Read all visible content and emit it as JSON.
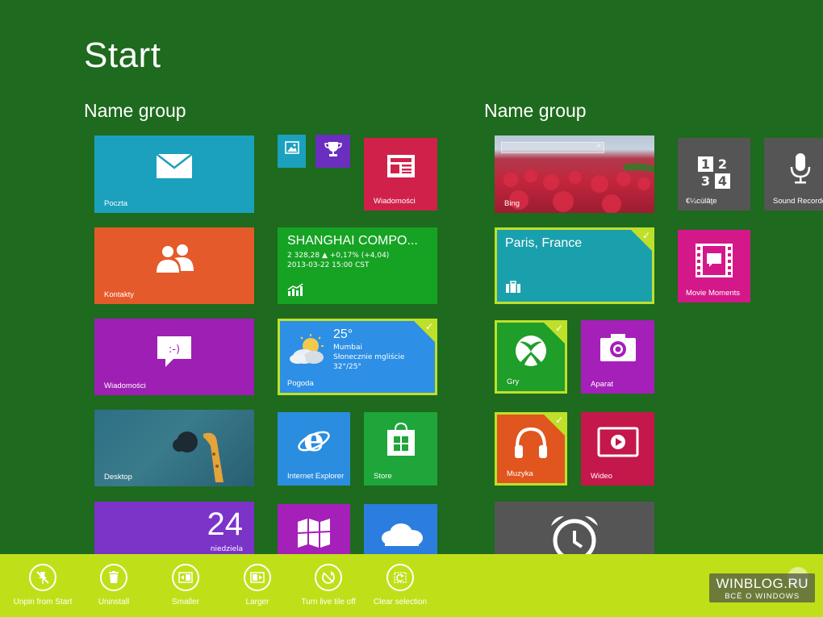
{
  "start_title": "Start",
  "groups": [
    {
      "title": "Name group"
    },
    {
      "title": "Name group"
    }
  ],
  "tiles": {
    "poczta": "Poczta",
    "wiadomosci_news": "Wiadomości",
    "kontakty": "Kontakty",
    "finance_title": "SHANGHAI COMPO...",
    "finance_line1": "2 328,28 ▲ +0,17% (+4,04)",
    "finance_line2": "2013-03-22 15:00 CST",
    "wiadomosci_msg": "Wiadomości",
    "weather_temp": "25°",
    "weather_city": "Mumbai",
    "weather_desc": "Słonecznie mgliście",
    "weather_range": "32°/25°",
    "pogoda": "Pogoda",
    "desktop": "Desktop",
    "ie": "Internet Explorer",
    "store": "Store",
    "calendar_day": "24",
    "calendar_weekday": "niedziela",
    "bing": "Bing",
    "travel_city": "Paris, France",
    "gry": "Gry",
    "aparat": "Aparat",
    "muzyka": "Muzyka",
    "wideo": "Wideo",
    "calculator": "€¼cùlâţe",
    "sound_recorder": "Sound Recorde",
    "movie_moments": "Movie Moments"
  },
  "appbar": {
    "unpin": "Unpin from Start",
    "uninstall": "Uninstall",
    "smaller": "Smaller",
    "larger": "Larger",
    "live_tile": "Turn live tile off",
    "clear": "Clear selection"
  },
  "watermark": {
    "line1": "WINBLOG.RU",
    "line2": "ВСЁ О WINDOWS"
  },
  "colors": {
    "background": "#1e6a1e",
    "appbar": "#bfe018",
    "selection": "#bfe02a",
    "mail": "#1ba1bd",
    "people": "#e55a2b",
    "messaging": "#9e1fb3",
    "news": "#d0214a",
    "finance": "#16a324",
    "weather": "#2d8fe5",
    "ie": "#2b8de0",
    "store": "#1ea63a",
    "calendar": "#7b33c8",
    "travel": "#1aa0ad",
    "games": "#1f9e2a",
    "camera": "#a420b8",
    "music": "#e0561e",
    "video": "#c4174a",
    "gray": "#555555",
    "movie": "#d4188a"
  }
}
